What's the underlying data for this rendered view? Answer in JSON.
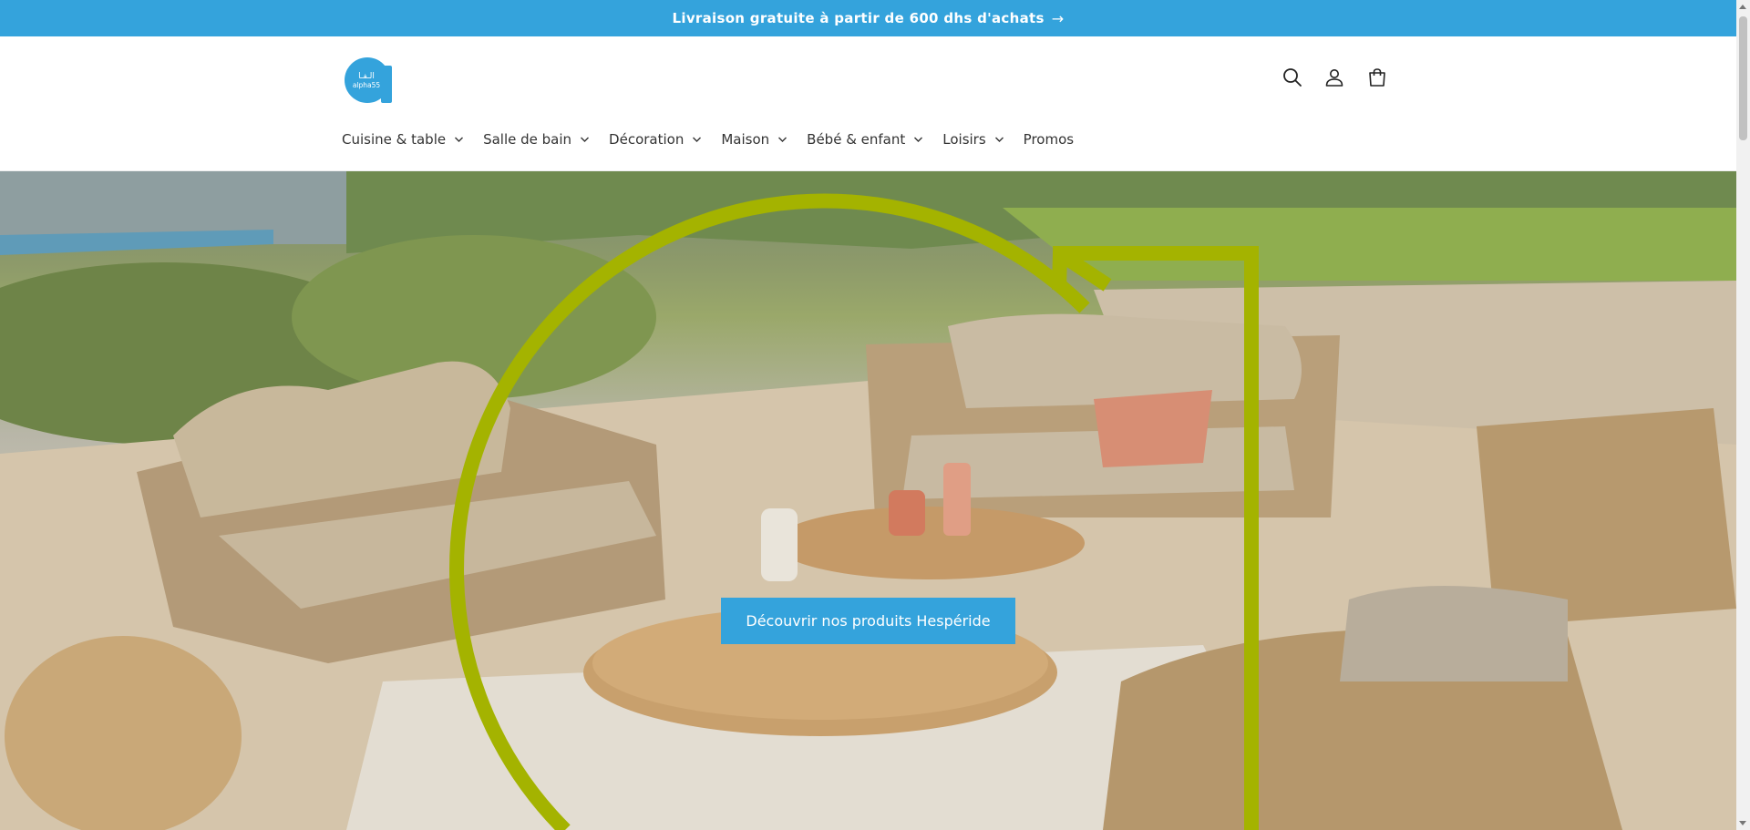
{
  "announcement": {
    "text": "Livraison gratuite à partir de 600 dhs d'achats",
    "arrow": "→"
  },
  "header": {
    "logo_arabic": "الـفـا",
    "logo_latin": "alpha55",
    "icons": [
      "search-icon",
      "account-icon",
      "cart-icon"
    ]
  },
  "nav": {
    "items": [
      {
        "label": "Cuisine & table",
        "has_dropdown": true
      },
      {
        "label": "Salle de bain",
        "has_dropdown": true
      },
      {
        "label": "Décoration",
        "has_dropdown": true
      },
      {
        "label": "Maison",
        "has_dropdown": true
      },
      {
        "label": "Bébé & enfant",
        "has_dropdown": true
      },
      {
        "label": "Loisirs",
        "has_dropdown": true
      },
      {
        "label": "Promos",
        "has_dropdown": false
      }
    ]
  },
  "hero": {
    "cta_label": "Découvrir nos produits Hespéride",
    "accent_color": "#a4b300"
  },
  "colors": {
    "brand": "#34a3dc",
    "text": "#333333"
  }
}
